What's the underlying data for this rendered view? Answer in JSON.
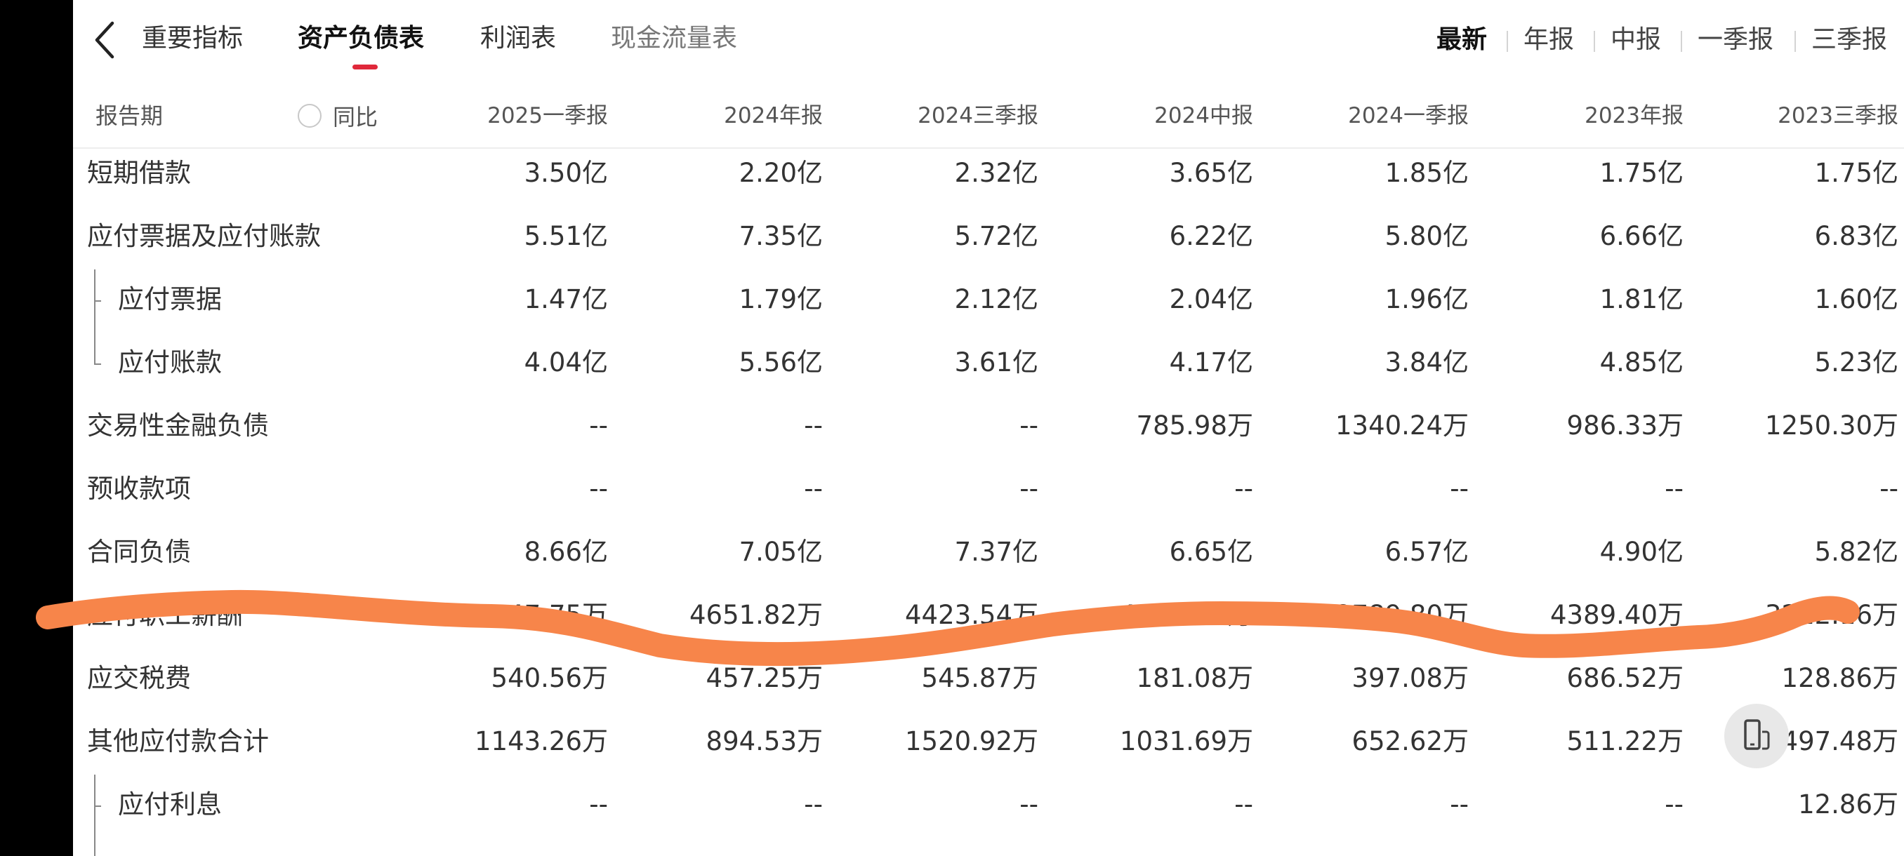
{
  "nav": {
    "tabs": [
      "重要指标",
      "资产负债表",
      "利润表",
      "现金流量表"
    ],
    "active_tab": 1,
    "periods": [
      "最新",
      "年报",
      "中报",
      "一季报",
      "三季报"
    ],
    "active_period": 0
  },
  "header": {
    "label": "报告期",
    "yoy_label": "同比",
    "columns": [
      "2025一季报",
      "2024年报",
      "2024三季报",
      "2024中报",
      "2024一季报",
      "2023年报",
      "2023三季报"
    ]
  },
  "rows": [
    {
      "label": "短期借款",
      "values": [
        "3.50亿",
        "2.20亿",
        "2.32亿",
        "3.65亿",
        "1.85亿",
        "1.75亿",
        "1.75亿"
      ]
    },
    {
      "label": "应付票据及应付账款",
      "values": [
        "5.51亿",
        "7.35亿",
        "5.72亿",
        "6.22亿",
        "5.80亿",
        "6.66亿",
        "6.83亿"
      ]
    },
    {
      "label": "应付票据",
      "values": [
        "1.47亿",
        "1.79亿",
        "2.12亿",
        "2.04亿",
        "1.96亿",
        "1.81亿",
        "1.60亿"
      ]
    },
    {
      "label": "应付账款",
      "values": [
        "4.04亿",
        "5.56亿",
        "3.61亿",
        "4.17亿",
        "3.84亿",
        "4.85亿",
        "5.23亿"
      ]
    },
    {
      "label": "交易性金融负债",
      "values": [
        "--",
        "--",
        "--",
        "785.98万",
        "1340.24万",
        "986.33万",
        "1250.30万"
      ]
    },
    {
      "label": "预收款项",
      "values": [
        "--",
        "--",
        "--",
        "--",
        "--",
        "--",
        "--"
      ]
    },
    {
      "label": "合同负债",
      "values": [
        "8.66亿",
        "7.05亿",
        "7.37亿",
        "6.65亿",
        "6.57亿",
        "4.90亿",
        "5.82亿"
      ]
    },
    {
      "label": "应付职工薪酬",
      "values": [
        "3147.75万",
        "4651.82万",
        "4423.54万",
        "4034.77万",
        "2789.80万",
        "4389.40万",
        "3212.16万"
      ]
    },
    {
      "label": "应交税费",
      "values": [
        "540.56万",
        "457.25万",
        "545.87万",
        "181.08万",
        "397.08万",
        "686.52万",
        "128.86万"
      ]
    },
    {
      "label": "其他应付款合计",
      "values": [
        "1143.26万",
        "894.53万",
        "1520.92万",
        "1031.69万",
        "652.62万",
        "511.22万",
        "497.48万"
      ]
    },
    {
      "label": "应付利息",
      "values": [
        "--",
        "--",
        "--",
        "--",
        "--",
        "--",
        "12.86万"
      ]
    }
  ],
  "icons": {
    "back": "chevron-left-icon",
    "float": "phone-rotate-icon"
  },
  "colors": {
    "accent": "#e0283a",
    "scribble": "#f7854a"
  }
}
